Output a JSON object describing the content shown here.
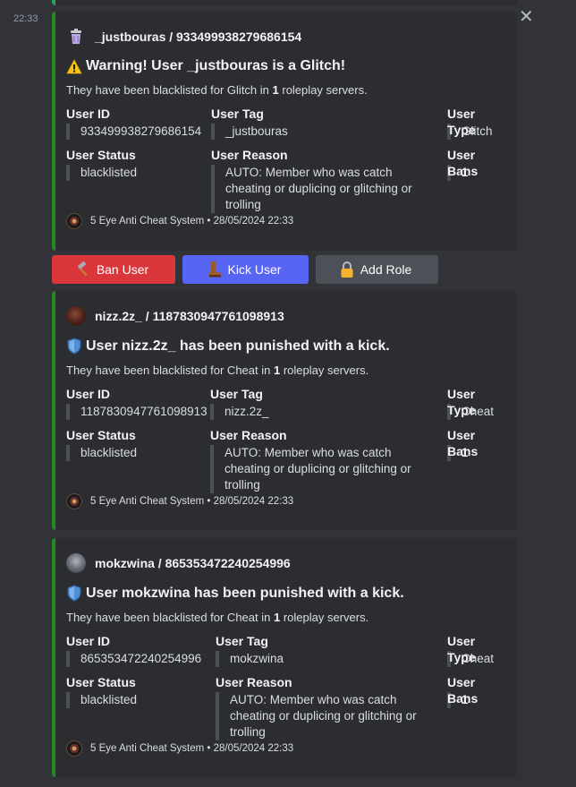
{
  "message": {
    "timestamp": "22:33"
  },
  "field_labels": {
    "user_id": "User ID",
    "user_tag": "User Tag",
    "user_type": "User Type",
    "user_status": "User Status",
    "user_reason": "User Reason",
    "user_bans": "User Bans"
  },
  "embeds": [
    {
      "author": "_justbouras / 933499938279686154",
      "title": "Warning! User _justbouras is a Glitch!",
      "title_icon": "warning-icon",
      "desc_prefix": "They have been blacklisted for Glitch in ",
      "desc_count": "1",
      "desc_suffix": " roleplay servers.",
      "user_id": "933499938279686154",
      "user_tag": "_justbouras",
      "user_type": "Glitch",
      "user_status": "blacklisted",
      "user_reason": "AUTO: Member who was catch cheating or duplicing or glitching or trolling",
      "user_bans": "1",
      "footer": "5 Eye Anti Cheat System • 28/05/2024 22:33"
    },
    {
      "author": "nizz.2z_ / 1187830947761098913",
      "title": "User nizz.2z_ has been punished with a kick.",
      "title_icon": "shield-icon",
      "desc_prefix": "They have been blacklisted for Cheat in ",
      "desc_count": "1",
      "desc_suffix": " roleplay servers.",
      "user_id": "1187830947761098913",
      "user_tag": "nizz.2z_",
      "user_type": "Cheat",
      "user_status": "blacklisted",
      "user_reason": "AUTO: Member who was catch cheating or duplicing or glitching or trolling",
      "user_bans": "1",
      "footer": "5 Eye Anti Cheat System • 28/05/2024 22:33"
    },
    {
      "author": "mokzwina / 865353472240254996",
      "title": "User mokzwina has been punished with a kick.",
      "title_icon": "shield-icon",
      "desc_prefix": "They have been blacklisted for Cheat in ",
      "desc_count": "1",
      "desc_suffix": " roleplay servers.",
      "user_id": "865353472240254996",
      "user_tag": "mokzwina",
      "user_type": "Cheat",
      "user_status": "blacklisted",
      "user_reason": "AUTO: Member who was catch cheating or duplicing or glitching or trolling",
      "user_bans": "1",
      "footer": "5 Eye Anti Cheat System • 28/05/2024 22:33"
    }
  ],
  "buttons": {
    "ban": {
      "label": "Ban User",
      "icon": "hammer-icon",
      "color": "#da373c"
    },
    "kick": {
      "label": "Kick User",
      "icon": "boot-icon",
      "color": "#5865f2"
    },
    "add_role": {
      "label": "Add Role",
      "icon": "lock-icon",
      "color": "#4e5058"
    }
  },
  "colors": {
    "embed_border": "#1e8c1e",
    "embed_bg": "#2b2d31",
    "background": "#313338"
  }
}
